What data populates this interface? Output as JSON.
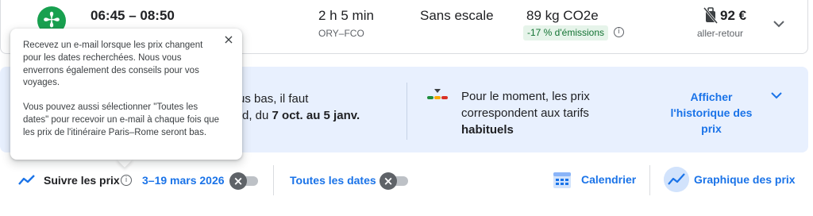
{
  "flight": {
    "logo_glyph": "✢",
    "times": "06:45 – 08:50",
    "duration": "2 h 5 min",
    "route": "ORY–FCO",
    "stops": "Sans escale",
    "co2": "89 kg CO2e",
    "co2_badge": "-17 % d'émissions",
    "price": "92 €",
    "trip_type": "aller-retour",
    "icons": {
      "baggage": "no-carry-on-bag-icon",
      "expand": "chevron-down-icon",
      "info": "info-icon"
    }
  },
  "insights": {
    "best_time_line1": "us bas, il faut",
    "best_time_line2_prefix": "rd, du ",
    "best_time_dates": "7 oct. au 5 janv.",
    "price_level_line1": "Pour le moment, les prix",
    "price_level_line2": "correspondent aux tarifs",
    "price_level_line3": "habituels",
    "history_link": "Afficher l'historique des prix",
    "icons": {
      "price_level": "price-level-indicator-icon",
      "collapse": "chevron-down-icon"
    }
  },
  "track": {
    "label": "Suivre les prix",
    "dates": "3–19 mars 2026",
    "all_dates_label": "Toutes les dates",
    "toggle_glyph": "×",
    "calendar_label": "Calendrier",
    "price_graph_label": "Graphique des prix",
    "icons": {
      "track": "trending-line-icon",
      "calendar": "calendar-icon",
      "graph": "price-graph-icon"
    }
  },
  "tooltip": {
    "paragraph1": "Recevez un e-mail lorsque les prix changent pour les dates recherchées. Nous vous enverrons également des conseils pour vos voyages.",
    "paragraph2": "Vous pouvez aussi sélectionner \"Toutes les dates\" pour recevoir un e-mail à chaque fois que les prix de l'itinéraire Paris–Rome seront bas.",
    "close_glyph": "×"
  },
  "colors": {
    "accent": "#1a73e8",
    "banner": "#e8f0fe",
    "badge_bg": "#e6f4ea",
    "badge_text": "#137333",
    "airline": "#18a04f"
  }
}
